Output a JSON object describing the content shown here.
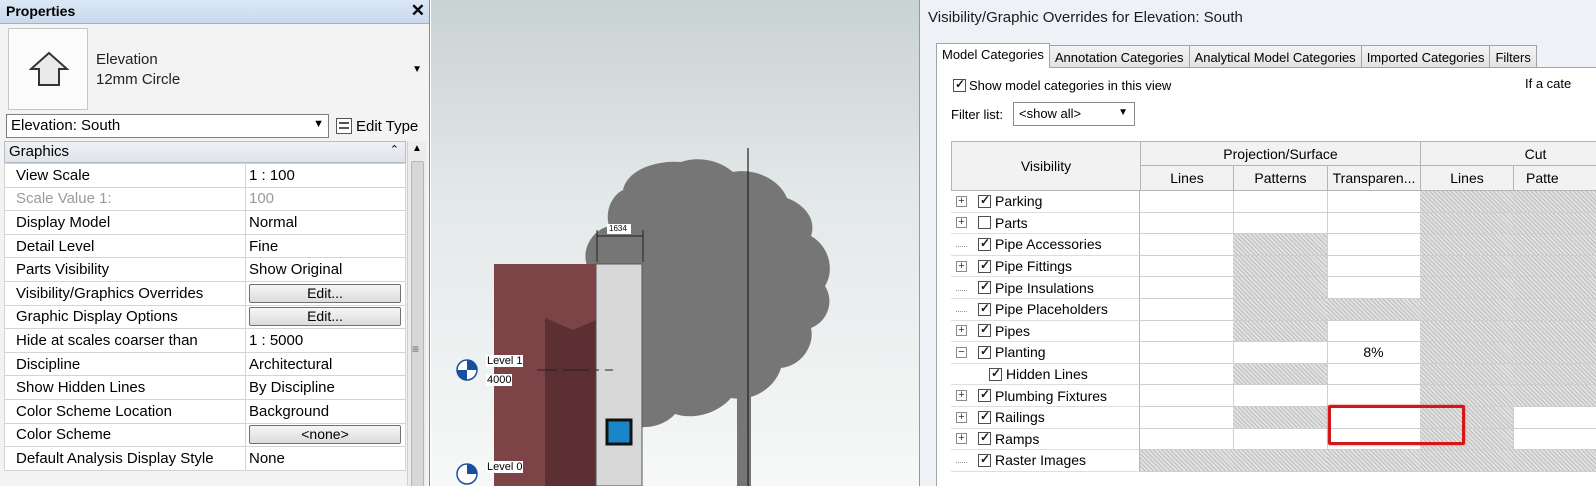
{
  "properties": {
    "title": "Properties",
    "type_family": "Elevation",
    "type_name": "12mm Circle",
    "instance_selector": "Elevation: South",
    "edit_type_label": "Edit Type",
    "group_label": "Graphics",
    "rows": [
      {
        "label": "View Scale",
        "value": "1 : 100"
      },
      {
        "label": "Scale Value    1:",
        "value": "100"
      },
      {
        "label": "Display Model",
        "value": "Normal"
      },
      {
        "label": "Detail Level",
        "value": "Fine"
      },
      {
        "label": "Parts Visibility",
        "value": "Show Original"
      },
      {
        "label": "Visibility/Graphics Overrides",
        "value": "Edit..."
      },
      {
        "label": "Graphic Display Options",
        "value": "Edit..."
      },
      {
        "label": "Hide at scales coarser than",
        "value": "1 : 5000"
      },
      {
        "label": "Discipline",
        "value": "Architectural"
      },
      {
        "label": "Show Hidden Lines",
        "value": "By Discipline"
      },
      {
        "label": "Color Scheme Location",
        "value": "Background"
      },
      {
        "label": "Color Scheme",
        "value": "<none>"
      },
      {
        "label": "Default Analysis Display Style",
        "value": "None"
      }
    ]
  },
  "canvas": {
    "level1_name": "Level 1",
    "level1_elev": "4000",
    "level0_name": "Level 0",
    "dimension": "1634"
  },
  "dialog": {
    "title": "Visibility/Graphic Overrides for Elevation: South",
    "tabs": [
      "Model Categories",
      "Annotation Categories",
      "Analytical Model Categories",
      "Imported Categories",
      "Filters"
    ],
    "show_model_categories": "Show model categories in this view",
    "if_a_category_text": "If a cate",
    "filter_list_label": "Filter list:",
    "filter_list_value": "<show all>",
    "headers": {
      "visibility": "Visibility",
      "projection_surface": "Projection/Surface",
      "cut": "Cut",
      "lines": "Lines",
      "patterns": "Patterns",
      "transparency": "Transparen...",
      "cut_lines": "Lines",
      "cut_patterns": "Patte"
    },
    "categories": [
      {
        "name": "Parking",
        "checked": true,
        "expandable": true,
        "expanded": false,
        "child": false
      },
      {
        "name": "Parts",
        "checked": false,
        "expandable": true,
        "expanded": false,
        "child": false
      },
      {
        "name": "Pipe Accessories",
        "checked": true,
        "expandable": false,
        "expanded": false,
        "child": false
      },
      {
        "name": "Pipe Fittings",
        "checked": true,
        "expandable": true,
        "expanded": false,
        "child": false
      },
      {
        "name": "Pipe Insulations",
        "checked": true,
        "expandable": false,
        "expanded": false,
        "child": false
      },
      {
        "name": "Pipe Placeholders",
        "checked": true,
        "expandable": false,
        "expanded": false,
        "child": false
      },
      {
        "name": "Pipes",
        "checked": true,
        "expandable": true,
        "expanded": false,
        "child": false
      },
      {
        "name": "Planting",
        "checked": true,
        "expandable": true,
        "expanded": true,
        "child": false,
        "transparency": "8%"
      },
      {
        "name": "Hidden Lines",
        "checked": true,
        "expandable": false,
        "expanded": false,
        "child": true
      },
      {
        "name": "Plumbing Fixtures",
        "checked": true,
        "expandable": true,
        "expanded": false,
        "child": false
      },
      {
        "name": "Railings",
        "checked": true,
        "expandable": true,
        "expanded": false,
        "child": false
      },
      {
        "name": "Ramps",
        "checked": true,
        "expandable": true,
        "expanded": false,
        "child": false
      },
      {
        "name": "Raster Images",
        "checked": true,
        "expandable": false,
        "expanded": false,
        "child": false
      }
    ]
  }
}
